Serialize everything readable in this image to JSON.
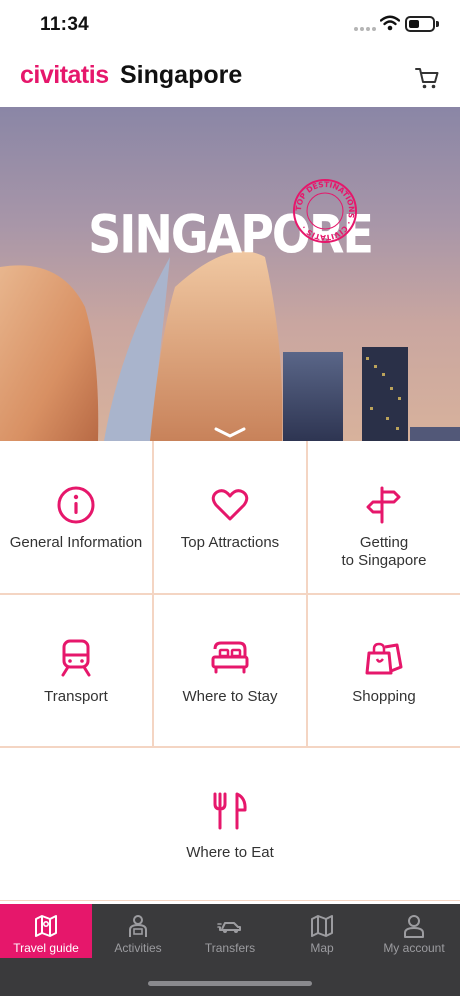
{
  "status_bar": {
    "time": "11:34",
    "battery_level": 0.35
  },
  "header": {
    "logo": "civitatis",
    "title": "Singapore",
    "cart_icon": "cart-icon"
  },
  "hero": {
    "title": "SINGAPORE",
    "stamp_text": "TOP DESTINATIONS · CIVITATIS ·",
    "scroll_icon": "chevron-down-icon"
  },
  "colors": {
    "brand": "#e6176b",
    "tabbar": "#3a3a3c",
    "tab_inactive": "#9c9ca0"
  },
  "menu": [
    {
      "label": "General Information",
      "icon": "info-icon"
    },
    {
      "label": "Top Attractions",
      "icon": "heart-icon"
    },
    {
      "label": "Getting\nto Singapore",
      "icon": "signpost-icon"
    },
    {
      "label": "Transport",
      "icon": "train-icon"
    },
    {
      "label": "Where to Stay",
      "icon": "bed-icon"
    },
    {
      "label": "Shopping",
      "icon": "shopping-bags-icon"
    },
    {
      "label": "Where to Eat",
      "icon": "fork-knife-icon"
    }
  ],
  "tabs": [
    {
      "label": "Travel guide",
      "icon": "map-icon",
      "active": true
    },
    {
      "label": "Activities",
      "icon": "guide-person-icon",
      "active": false
    },
    {
      "label": "Transfers",
      "icon": "car-icon",
      "active": false
    },
    {
      "label": "Map",
      "icon": "folded-map-icon",
      "active": false
    },
    {
      "label": "My account",
      "icon": "user-icon",
      "active": false
    }
  ]
}
